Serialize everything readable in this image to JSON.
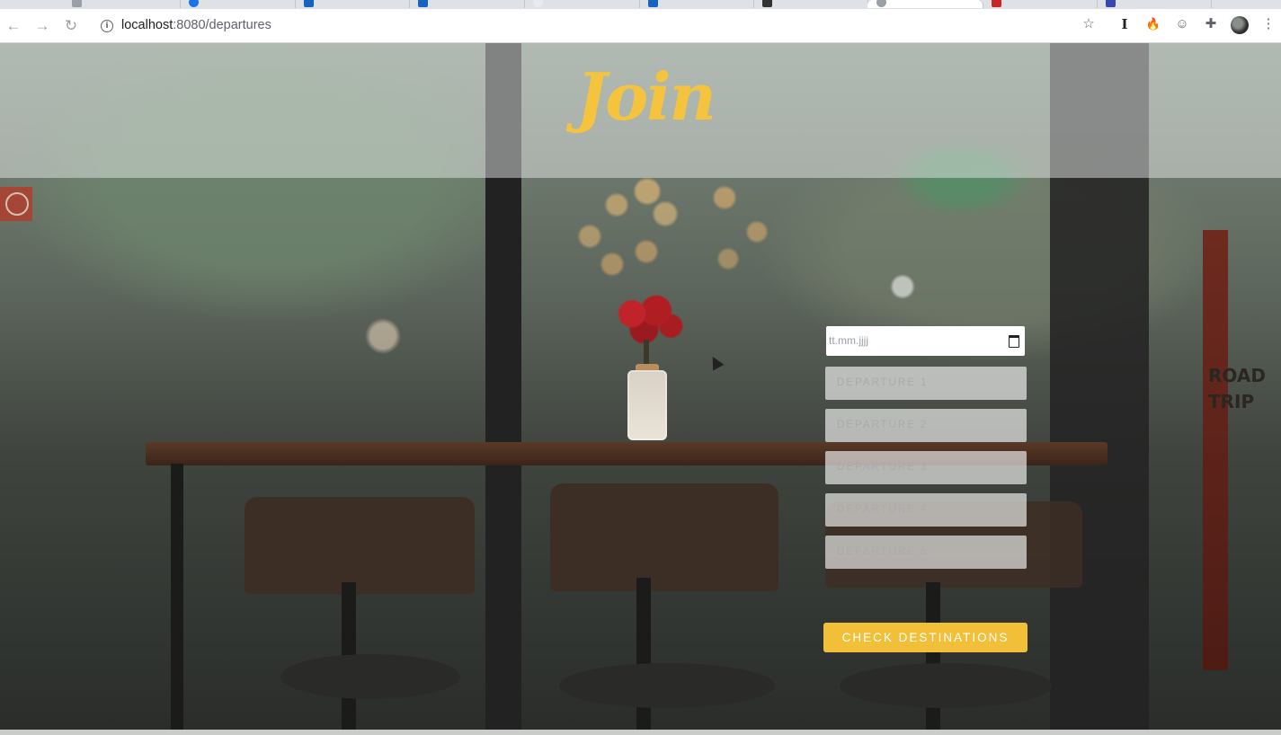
{
  "browser": {
    "url_host": "localhost",
    "url_rest": ":8080/departures",
    "tabs": [
      {
        "fav_color": "#9aa0a6"
      },
      {
        "fav_color": "#1a73e8"
      },
      {
        "fav_color": "#1565c0"
      },
      {
        "fav_color": "#1565c0"
      },
      {
        "fav_color": "#e8eaed"
      },
      {
        "fav_color": "#1565c0"
      },
      {
        "fav_color": "#333333"
      },
      {
        "fav_color": "#9aa0a6",
        "active": true
      },
      {
        "fav_color": "#c62828"
      },
      {
        "fav_color": "#3949ab"
      }
    ],
    "nav": {
      "back": "←",
      "forward": "→",
      "reload": "↻"
    },
    "extensions": {
      "star": "☆",
      "ext_i": "I",
      "ext_fire": "🔥",
      "ext_face": "☺",
      "puzzle": "✚",
      "menu": "⋮"
    }
  },
  "page": {
    "logo": "Join",
    "form": {
      "date_placeholder": "tt.mm.jjjj",
      "departures": [
        "DEPARTURE 1",
        "DEPARTURE 2",
        "DEPARTURE 3",
        "DEPARTURE 4",
        "DEPARTURE 5"
      ],
      "submit_label": "CHECK DESTINATIONS"
    },
    "sign_letters": "ROAD TRIP"
  },
  "colors": {
    "accent": "#f2c038",
    "logo": "#f4c43f"
  }
}
